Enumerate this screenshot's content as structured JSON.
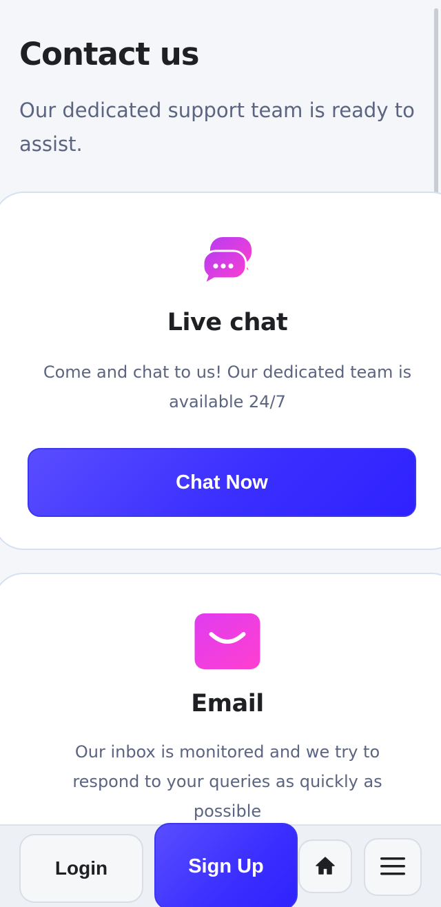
{
  "header": {
    "title": "Contact us",
    "subtitle": "Our dedicated support team is ready to assist."
  },
  "cards": {
    "live_chat": {
      "icon": "chat-bubbles-icon",
      "heading": "Live chat",
      "text": "Come and chat to us! Our dedicated team is available 24/7",
      "button_label": "Chat Now"
    },
    "email": {
      "icon": "envelope-icon",
      "heading": "Email",
      "text": "Our inbox is monitored and we try to respond to your queries as quickly as possible"
    }
  },
  "bottom_nav": {
    "login_label": "Login",
    "signup_label": "Sign Up",
    "home_icon": "home-icon",
    "menu_icon": "menu-icon"
  },
  "colors": {
    "accent": "#3a2fff",
    "icon_gradient_start": "#c43ef5",
    "icon_gradient_end": "#ff3fd0",
    "muted_text": "#5b6480"
  }
}
